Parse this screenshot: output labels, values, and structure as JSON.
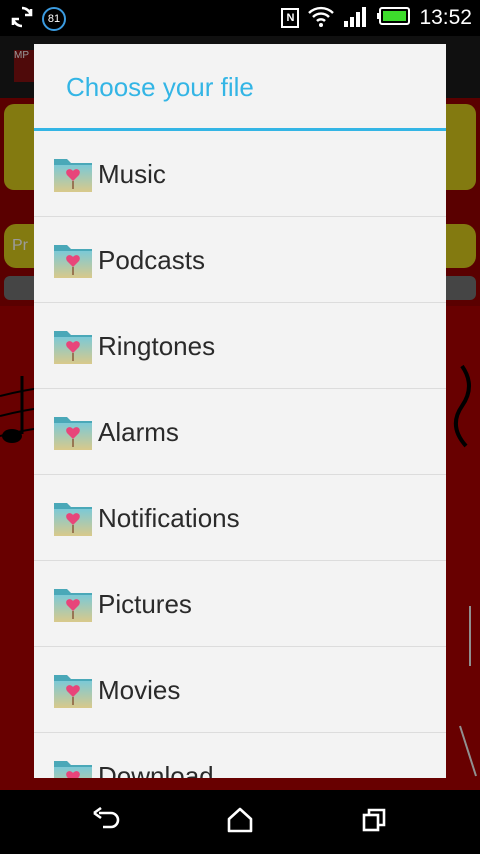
{
  "status_bar": {
    "notification_badge": "81",
    "nfc_label": "N",
    "time": "13:52",
    "colors": {
      "battery": "#3ddc2c",
      "badge_ring": "#3b9be0"
    },
    "icons": [
      "sync-icon",
      "nfc-icon",
      "wifi-icon",
      "signal-icon",
      "battery-icon"
    ]
  },
  "background_app": {
    "logo_text": "MP",
    "input_prefix": "Pr"
  },
  "dialog": {
    "title": "Choose your file",
    "accent_color": "#33b5e5",
    "items": [
      {
        "label": "Music"
      },
      {
        "label": "Podcasts"
      },
      {
        "label": "Ringtones"
      },
      {
        "label": "Alarms"
      },
      {
        "label": "Notifications"
      },
      {
        "label": "Pictures"
      },
      {
        "label": "Movies"
      },
      {
        "label": "Download"
      }
    ]
  },
  "nav_bar": {
    "icons": [
      "back-icon",
      "home-icon",
      "recents-icon"
    ]
  }
}
